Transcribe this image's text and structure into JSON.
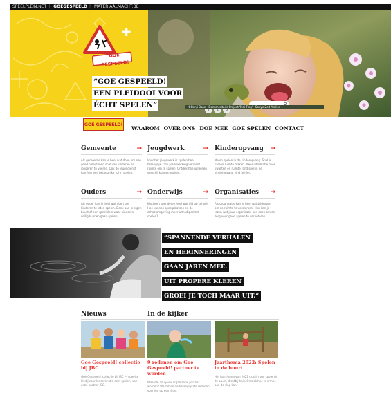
{
  "topbar": {
    "items": [
      {
        "label": "SPEELPLEIN.NET",
        "active": false
      },
      {
        "label": "GOEGESPEELD",
        "active": true
      },
      {
        "label": "MATERIAALMACHT.BE",
        "active": false
      }
    ]
  },
  "hero": {
    "logo_text": "GOE GESPEELD!",
    "title_lines": [
      "“GOE GESPEELD!",
      "EEN PLEIDOOI VOOR",
      "ÉCHT SPELEN”"
    ],
    "photo_caption": "©Benji Baan - Documentaire Project 'Mei Ting' - Sodye Zed Atelier",
    "social_icons": [
      "facebook-icon",
      "twitter-icon",
      "instagram-icon"
    ],
    "social_glyphs": [
      "f",
      "t",
      "o"
    ],
    "search_glyph": "⚲"
  },
  "nav": {
    "logo_text": "GOE GESPEELD!",
    "items": [
      "WAAROM",
      "OVER ONS",
      "DOE MEE",
      "GOE SPELEN",
      "CONTACT"
    ]
  },
  "categories": [
    {
      "title": "Gemeente",
      "text": "Als gemeente kan je heel wat doen om een goed beleid rond spel van kinderen en jongeren te voeren. Ook de jeugddienst kan hier een belangrijke rol in spelen."
    },
    {
      "title": "Jeugdwerk",
      "text": "Voor het jeugdwerk is spelen heel belangrijk. Ook jullie werking verdient ruimte om te spelen. Ontdek hoe jullie een verschil kunnen maken."
    },
    {
      "title": "Kinderopvang",
      "text": "Neem spelen in de kinderopvang. Spel is samen ruimte maken. Meer informatie over kwaliteit en ruimte rond spel in de kinderopvang vind je hier."
    },
    {
      "title": "Ouders",
      "text": "Als ouder kan je heel wat doen om kinderen te laten spelen. Denk aan je eigen buurt of een speelplein waar kinderen veilig kunnen gaan spelen."
    },
    {
      "title": "Onderwijs",
      "text": "Kinderen spenderen heel wat tijd op school. Hoe kunnen speelplaatsen en de schoolomgeving meer uitnodigen tot spelen?"
    },
    {
      "title": "Organisaties",
      "text": "Als organisatie kan je heel wat bijdragen om de ruimte te versterken. Hier kan je lezen wat jouw organisatie kan doen om de zorg voor goed spelen te verbeteren."
    }
  ],
  "category_arrow": "→",
  "quote": {
    "lines": [
      "“SPANNENDE VERHALEN",
      "EN HERINNERINGEN",
      "GAAN JAREN MEE.",
      "UIT PROPERE KLEREN",
      "GROEI JE TOCH MAAR UIT.”"
    ]
  },
  "news": {
    "heading": "Nieuws",
    "kijker_heading": "In de kijker",
    "cards": [
      {
        "title": "Goe Gespeeld! collectie bij JBC",
        "text": "Goe Gespeeld! collectie bij JBC — speelse kledij voor kinderen die echt spelen, van onze partner JBC."
      },
      {
        "title": "9 redenen om Goe Gespeeld! partner te worden",
        "text": "Waarom zou jouw organisatie partner worden? We zetten de belangrijkste redenen voor jou op een rijtje."
      },
      {
        "title": "Jaarthema 2022: Spelen in de buurt",
        "text": "Het jaarthema van 2022 draait rond spelen in de buurt, dichtbij huis. Ontdek hoe je ermee aan de slag kan."
      }
    ]
  },
  "colors": {
    "brand_yellow": "#f7d21a",
    "accent_red": "#e53935",
    "black": "#111111"
  }
}
